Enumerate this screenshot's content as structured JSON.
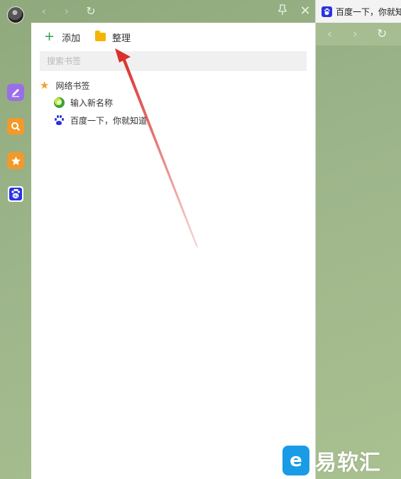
{
  "nav": {
    "back_icon": "‹",
    "forward_icon": "›",
    "refresh_icon": "↻",
    "pin_icon": "⊥",
    "close_icon": "✕"
  },
  "rail": {
    "items": [
      "edit-icon",
      "search-icon",
      "star-icon",
      "baidu-icon"
    ]
  },
  "panel": {
    "add_label": "添加",
    "organize_label": "整理",
    "search_placeholder": "搜索书签",
    "folder_label": "网络书签",
    "bookmarks": [
      {
        "label": "输入新名称",
        "icon": "browser-icon"
      },
      {
        "label": "百度一下，你就知道",
        "icon": "baidu-paw-icon"
      }
    ]
  },
  "right_tab": {
    "title": "百度一下，你就知道"
  },
  "watermark": {
    "text": "易软汇",
    "logo": "e"
  },
  "colors": {
    "accent_add": "#2f9e4a",
    "folder": "#f5b400",
    "star": "#f0a030",
    "arrow": "#d9302c",
    "baidu": "#2932e1"
  }
}
